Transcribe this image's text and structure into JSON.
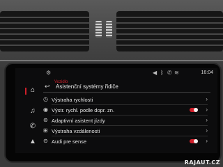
{
  "status_bar": {
    "time": "16:04",
    "icons": [
      "navigation-icon",
      "bluetooth-icon",
      "phone-icon",
      "wifi-icon"
    ]
  },
  "sidebar": {
    "items": [
      {
        "icon": "home-icon",
        "glyph": "⌂"
      },
      {
        "icon": "music-icon",
        "glyph": "♫"
      },
      {
        "icon": "phone-icon",
        "glyph": "✆"
      },
      {
        "icon": "navigation-icon",
        "glyph": "▲"
      }
    ],
    "active_index": 0,
    "accent": "#d01f2a"
  },
  "breadcrumb": "Vozidlo",
  "page_title": "Asistenční systémy řidiče",
  "rows": [
    {
      "label": "Výstraha rychlosti",
      "icon": "speed-warning-icon",
      "glyph": "◷",
      "control": "chevron"
    },
    {
      "label": "Výstr. rychl. podle dopr. zn.",
      "icon": "traffic-sign-icon",
      "glyph": "◉",
      "control": "toggle",
      "toggle_on": true
    },
    {
      "label": "Adaptivní asistent jízdy",
      "icon": "adaptive-assist-icon",
      "glyph": "⊜",
      "control": "chevron"
    },
    {
      "label": "Výstraha vzdálenosti",
      "icon": "distance-warning-icon",
      "glyph": "⊞",
      "control": "chevron"
    },
    {
      "label": "Audi pre sense",
      "icon": "pre-sense-icon",
      "glyph": "⊝",
      "control": "toggle",
      "toggle_on": true
    }
  ],
  "watermark": "RAJAUT.CZ"
}
